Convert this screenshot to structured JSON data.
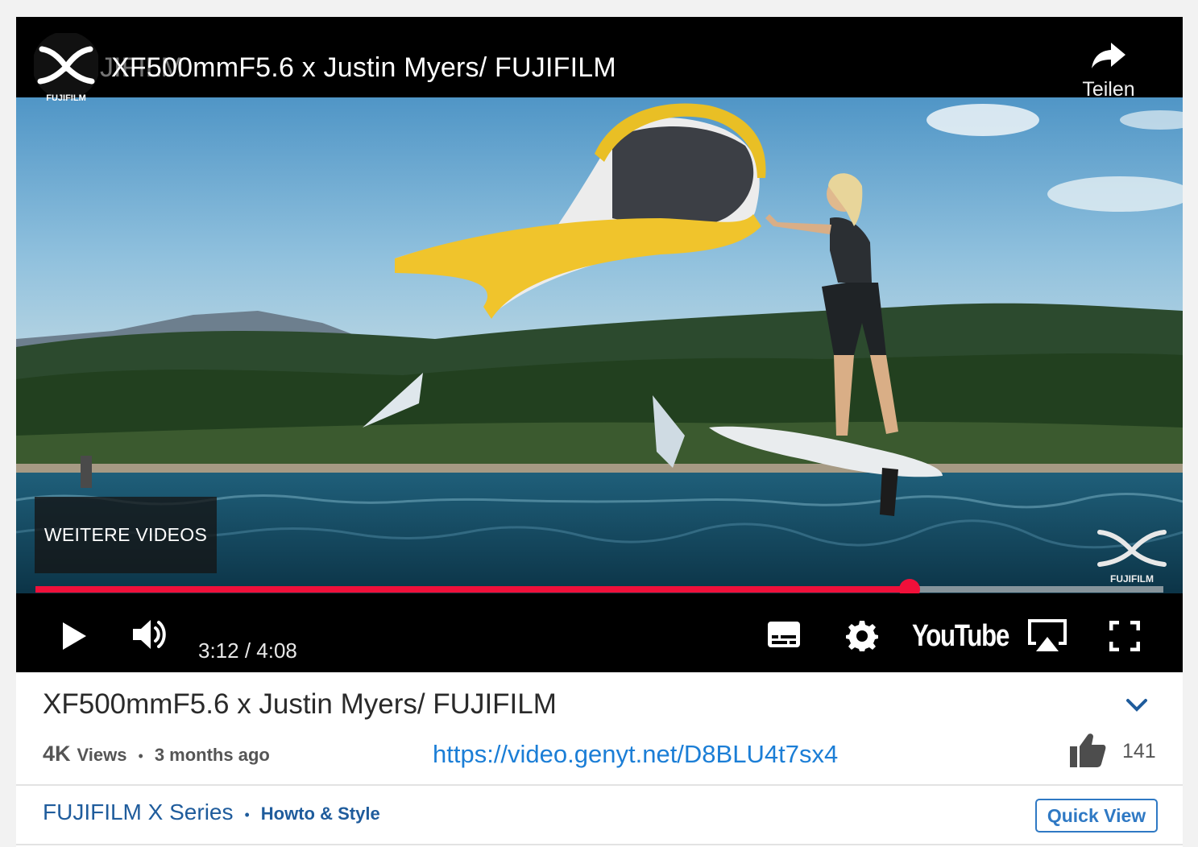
{
  "player": {
    "title": "XF500mmF5.6 x Justin Myers/ FUJIFILM",
    "ghost_logo_text": "JIFILM",
    "avatar_brand": "FUJIFILM",
    "share_label": "Teilen",
    "more_videos_label": "WEITERE VIDEOS",
    "watermark_brand": "FUJIFILM",
    "current_time": "3:12",
    "duration": "4:08",
    "time_display": "3:12 / 4:08",
    "progress_fraction": 0.775,
    "youtube_label": "YouTube",
    "progress_color": "#f0103a",
    "icons": [
      "play-icon",
      "volume-icon",
      "subtitles-icon",
      "settings-icon",
      "airplay-icon",
      "fullscreen-icon",
      "share-icon"
    ]
  },
  "info": {
    "title": "XF500mmF5.6 x Justin Myers/ FUJIFILM",
    "views_count": "4K",
    "views_label": "Views",
    "separator": "•",
    "age": "3 months ago",
    "link": "https://video.genyt.net/D8BLU4t7sx4",
    "likes": "141",
    "link_color": "#1b7ed6"
  },
  "footer": {
    "channel": "FUJIFILM X Series",
    "separator": "•",
    "category": "Howto & Style",
    "quick_view_label": "Quick View",
    "accent_color": "#1f5c9c"
  }
}
